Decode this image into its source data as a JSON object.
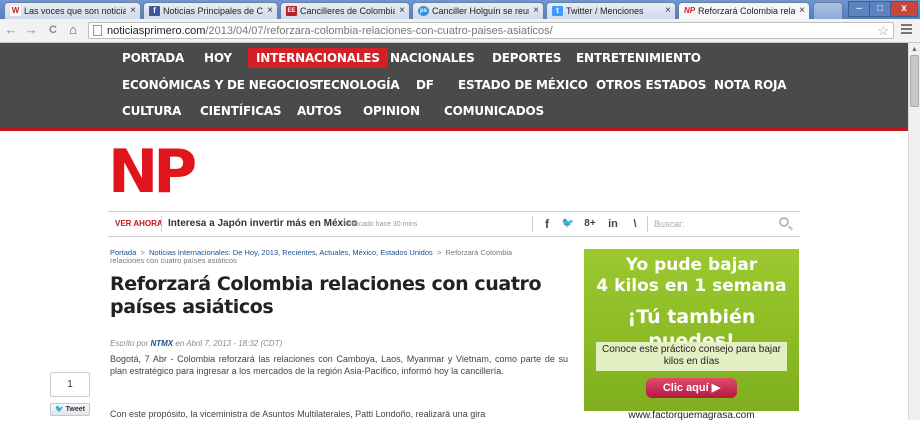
{
  "browser": {
    "tabs": [
      {
        "icon": "W",
        "icon_color": "#c11d1d",
        "title": "Las voces que son noticia en..."
      },
      {
        "icon": "f",
        "icon_color": "#3b5998",
        "title": "Noticias Principales de Colo..."
      },
      {
        "icon": "EE",
        "icon_color": "#b6202b",
        "title": "Cancilleres de Colombia y Su..."
      },
      {
        "icon": "ps",
        "icon_color": "#2d8fd5",
        "title": "Canciller Holguín se reune c..."
      },
      {
        "icon": "t",
        "icon_color": "#4099ff",
        "title": "Twitter / Menciones"
      },
      {
        "icon": "NP",
        "icon_color": "#d41f26",
        "title": "Reforzará Colombia relacion..."
      }
    ],
    "tab_close": "×",
    "url_host": "noticiasprimero.com",
    "url_path": "/2013/04/07/reforzara-colombia-relaciones-con-cuatro-paises-asiaticos/",
    "back": "←",
    "forward": "→",
    "reload": "C",
    "home": "⌂",
    "star": "☆",
    "win_min": "–",
    "win_max": "□",
    "win_close": "x"
  },
  "nav": {
    "row1": [
      "PORTADA",
      "HOY",
      "INTERNACIONALES",
      "NACIONALES",
      "DEPORTES",
      "ENTRETENIMIENTO"
    ],
    "row2": [
      "ECONÓMICAS Y DE NEGOCIOS",
      "TECNOLOGÍA",
      "DF",
      "ESTADO DE MÉXICO",
      "OTROS ESTADOS",
      "NOTA ROJA"
    ],
    "row3": [
      "CULTURA",
      "CIENTÍFICAS",
      "AUTOS",
      "OPINION",
      "COMUNICADOS"
    ],
    "active": "INTERNACIONALES",
    "active_color": "#d41f26"
  },
  "logo": "NP",
  "ticker": {
    "label": "VER AHORA",
    "headline": "Interesa a Japón invertir más en México",
    "published": "Publicado hace 30 mins",
    "social": [
      "f",
      "🐦",
      "8+",
      "in",
      "\\"
    ],
    "search_placeholder": "Buscar:"
  },
  "breadcrumb": {
    "home": "Portada",
    "sep": ">",
    "cats": "Noticias Internacionales: De Hoy, 2013, Recientes, Actuales, México, Estados Unidos",
    "current": "Reforzará Colombia relaciones con cuatro países asiáticos"
  },
  "article": {
    "title": "Reforzará Colombia relaciones con cuatro países asiáticos",
    "byline_pre": "Escrito por",
    "author": "NTMX",
    "byline_post": "en Abril 7, 2013 - 18:32 (CDT)",
    "p1": "Bogotá, 7 Abr - Colombia reforzará las relaciones con Camboya, Laos, Myanmar y Vietnam, como parte de su plan estratégico para ingresar a los mercados de la región Asia-Pacífico, informó hoy la cancillería.",
    "p2": "Con este propósito, la viceministra de Asuntos Multilaterales, Patti Londoño, realizará una gira"
  },
  "share": {
    "count": "1",
    "tweet": "Tweet"
  },
  "ad": {
    "line1": "Yo pude bajar",
    "line2": "4 kilos en 1 semana",
    "line3": "¡Tú también puedes!",
    "sub": "Conoce este práctico consejo para bajar kilos en días",
    "button": "Clic aquí ▶",
    "url": "www.factorquemagrasa.com"
  }
}
